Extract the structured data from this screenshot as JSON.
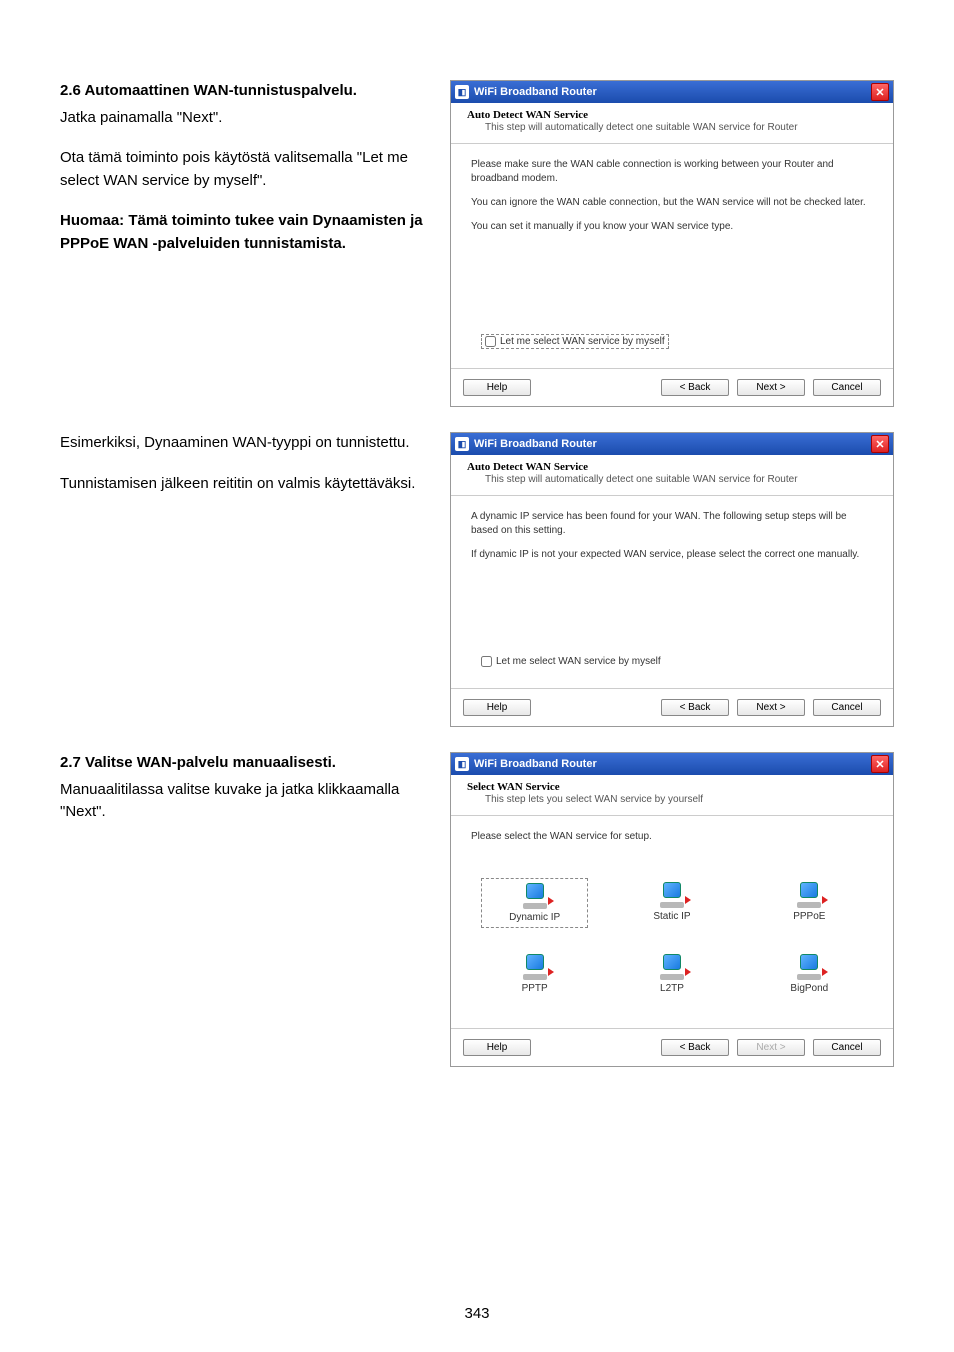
{
  "section1": {
    "heading": "2.6 Automaattinen WAN-tunnistuspalvelu.",
    "p1": "Jatka painamalla \"Next\".",
    "p2": "Ota tämä toiminto pois käytöstä valitsemalla \"Let me select WAN service by myself\".",
    "note": "Huomaa: Tämä toiminto tukee vain Dynaamisten ja PPPoE WAN -palveluiden tunnistamista."
  },
  "section2": {
    "p1": "Esimerkiksi, Dynaaminen WAN-tyyppi on tunnistettu.",
    "p2": "Tunnistamisen jälkeen reititin on valmis käytettäväksi."
  },
  "section3": {
    "heading": "2.7 Valitse WAN-palvelu manuaalisesti.",
    "p1": "Manuaalitilassa valitse kuvake ja jatka klikkaamalla \"Next\"."
  },
  "dlg1": {
    "title": "WiFi Broadband Router",
    "head_title": "Auto Detect WAN Service",
    "head_sub": "This step will automatically detect one suitable WAN service for Router",
    "body_p1": "Please make sure the WAN cable connection is working between your Router and broadband modem.",
    "body_p2": "You can ignore the WAN cable connection, but the WAN service will not be checked later.",
    "body_p3": "You can set it manually if you know your WAN service type.",
    "chk_label": "Let me select WAN service by myself",
    "btn_help": "Help",
    "btn_back": "< Back",
    "btn_next": "Next >",
    "btn_cancel": "Cancel"
  },
  "dlg2": {
    "title": "WiFi Broadband Router",
    "head_title": "Auto Detect WAN Service",
    "head_sub": "This step will automatically detect one suitable WAN service for Router",
    "body_p1": "A dynamic IP service has been found for your WAN. The following setup steps will be based on this setting.",
    "body_p2": "If dynamic IP is not your expected WAN service, please select the correct one manually.",
    "chk_label": "Let me select WAN service by myself",
    "btn_help": "Help",
    "btn_back": "< Back",
    "btn_next": "Next >",
    "btn_cancel": "Cancel"
  },
  "dlg3": {
    "title": "WiFi Broadband Router",
    "head_title": "Select WAN Service",
    "head_sub": "This step lets you select WAN service by yourself",
    "body_p1": "Please select the WAN service for setup.",
    "items": [
      {
        "label": "Dynamic IP"
      },
      {
        "label": "Static IP"
      },
      {
        "label": "PPPoE"
      },
      {
        "label": "PPTP"
      },
      {
        "label": "L2TP"
      },
      {
        "label": "BigPond"
      }
    ],
    "btn_help": "Help",
    "btn_back": "< Back",
    "btn_next": "Next >",
    "btn_cancel": "Cancel"
  },
  "page_number": "343"
}
